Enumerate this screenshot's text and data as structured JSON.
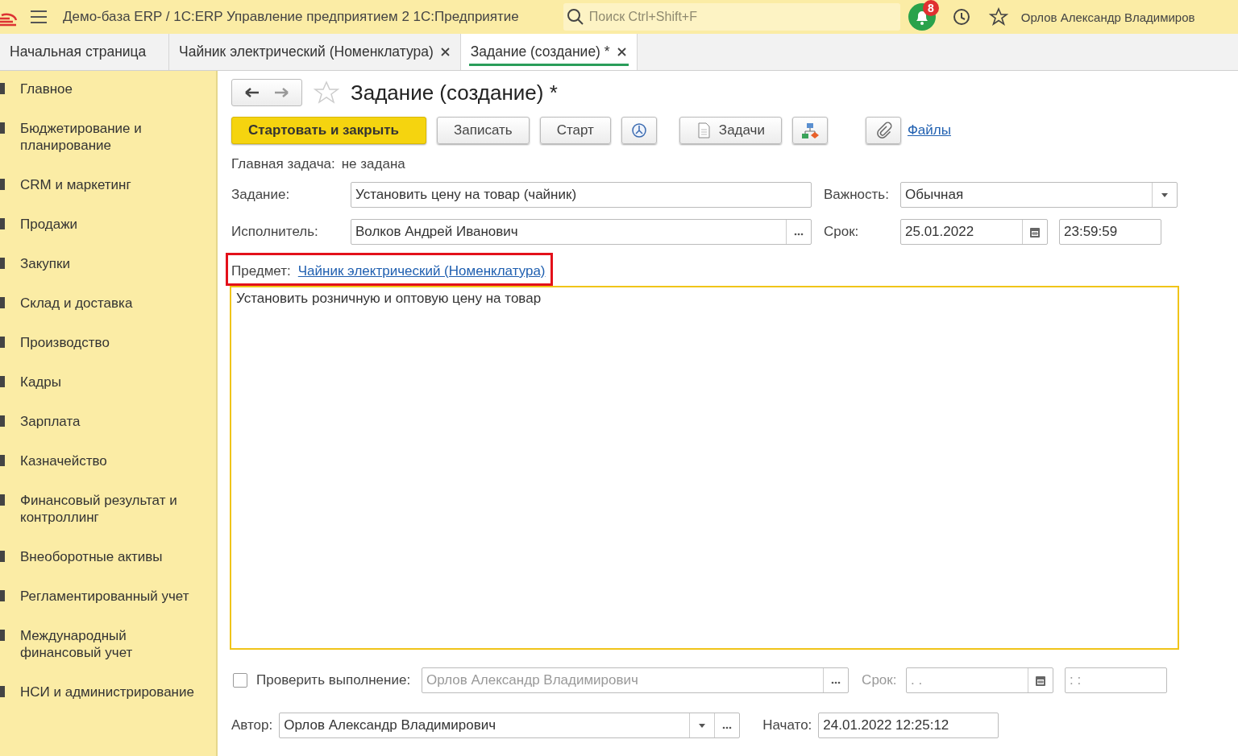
{
  "header": {
    "title": "Демо-база ERP / 1С:ERP Управление предприятием 2 1С:Предприятие",
    "search": {
      "placeholder": "Поиск Ctrl+Shift+F"
    },
    "notification_count": "8",
    "user": "Орлов Александр Владимиров"
  },
  "tabs": [
    {
      "label": "Начальная страница",
      "selected": false,
      "closable": false
    },
    {
      "label": "Чайник электрический (Номенклатура)",
      "selected": false,
      "closable": true
    },
    {
      "label": "Задание (создание) *",
      "selected": true,
      "closable": true
    }
  ],
  "sidebar": {
    "items": [
      "Главное",
      "Бюджетирование и планирование",
      "CRM и маркетинг",
      "Продажи",
      "Закупки",
      "Склад и доставка",
      "Производство",
      "Кадры",
      "Зарплата",
      "Казначейство",
      "Финансовый результат и контроллинг",
      "Внеоборотные активы",
      "Регламентированный учет",
      "Международный финансовый учет",
      "НСИ и администрирование"
    ]
  },
  "form": {
    "title": "Задание (создание) *",
    "toolbar": [
      {
        "kind": "primary",
        "label": "Стартовать и закрыть"
      },
      {
        "kind": "plain",
        "label": "Записать"
      },
      {
        "kind": "plain",
        "label": "Старт"
      },
      {
        "kind": "icon"
      },
      {
        "kind": "document",
        "label": "Задачи"
      },
      {
        "kind": "icon"
      },
      {
        "kind": "icon"
      },
      {
        "kind": "link",
        "label": "Файлы"
      }
    ],
    "main_task": {
      "label": "Главная задача:",
      "value": "не задана"
    },
    "task": {
      "label": "Задание:",
      "value": "Установить цену на товар (чайник)"
    },
    "importance": {
      "label": "Важность:",
      "value": "Обычная"
    },
    "executor": {
      "label": "Исполнитель:",
      "value": "Волков Андрей Иванович"
    },
    "deadline": {
      "label": "Срок:",
      "date": "25.01.2022",
      "time": "23:59:59"
    },
    "subject": {
      "label": "Предмет:",
      "link": "Чайник электрический (Номенклатура)",
      "highlighted": true
    },
    "description": "Установить розничную и оптовую цену на товар",
    "verify": {
      "checked": false,
      "disabled": true,
      "label": "Проверить выполнение:",
      "value": "Орлов Александр Владимирович",
      "deadline_label": "Срок:",
      "date": ".  .",
      "time": ":  :"
    },
    "author": {
      "label": "Автор:",
      "value": "Орлов Александр Владимирович"
    },
    "started": {
      "label": "Начато:",
      "value": "24.01.2022 12:25:12"
    }
  }
}
